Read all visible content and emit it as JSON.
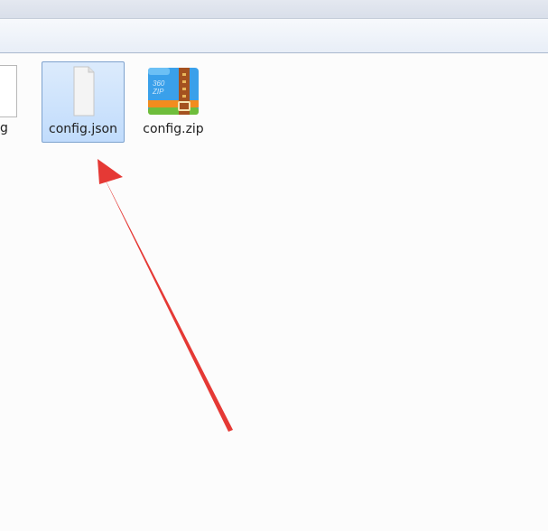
{
  "files": [
    {
      "label": "config.json",
      "icon": "blank-document-icon",
      "selected": true
    },
    {
      "label": "config.zip",
      "icon": "360zip-archive-icon",
      "selected": false
    }
  ],
  "partial_file": {
    "label_tail": "g",
    "icon": "blank-document-icon"
  },
  "zip_icon_text": {
    "line1": "360",
    "line2": "ZIP"
  },
  "annotation": {
    "type": "arrow",
    "color": "#e53935",
    "points_to": "config.json"
  },
  "colors": {
    "selection_fill": "#cce4ff",
    "selection_border": "#7da2ce",
    "background": "#fcfcfc",
    "arrow": "#e53935"
  }
}
